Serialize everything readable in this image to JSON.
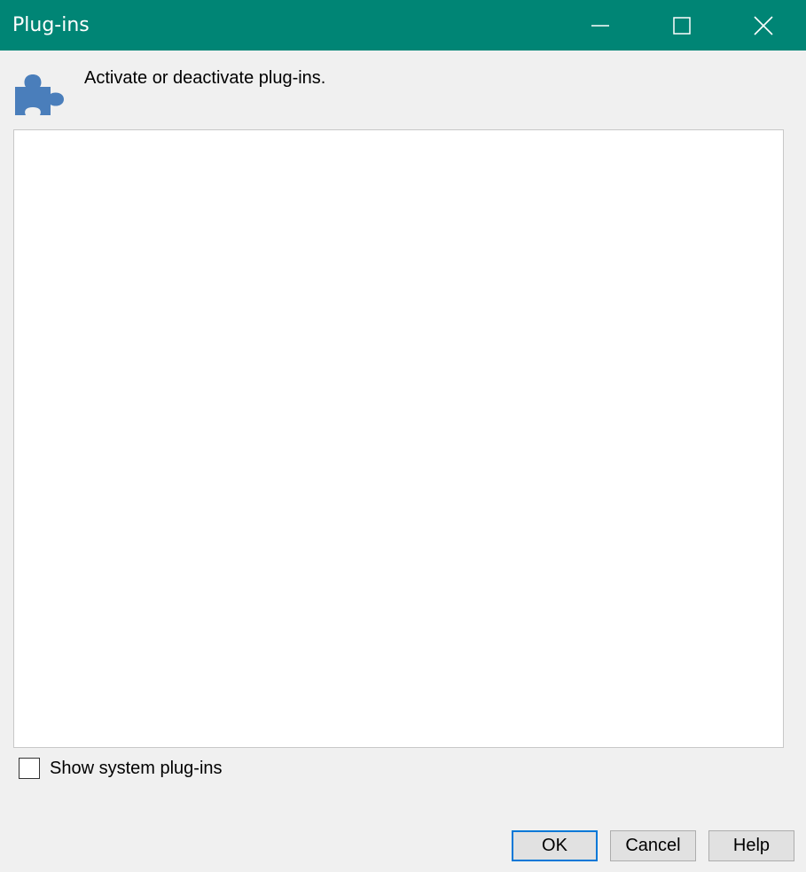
{
  "window": {
    "title": "Plug-ins",
    "titlebar_color": "#008575",
    "controls": {
      "minimize_icon": "minimize-icon",
      "maximize_icon": "maximize-icon",
      "close_icon": "close-icon"
    }
  },
  "header": {
    "icon": "puzzle-piece-icon",
    "icon_color": "#4a7ebb",
    "description": "Activate or deactivate plug-ins."
  },
  "plugin_list": {
    "items": []
  },
  "options": {
    "show_system_label": "Show system plug-ins",
    "show_system_checked": false
  },
  "buttons": {
    "ok_label": "OK",
    "cancel_label": "Cancel",
    "help_label": "Help",
    "default_border_color": "#0078d7"
  }
}
